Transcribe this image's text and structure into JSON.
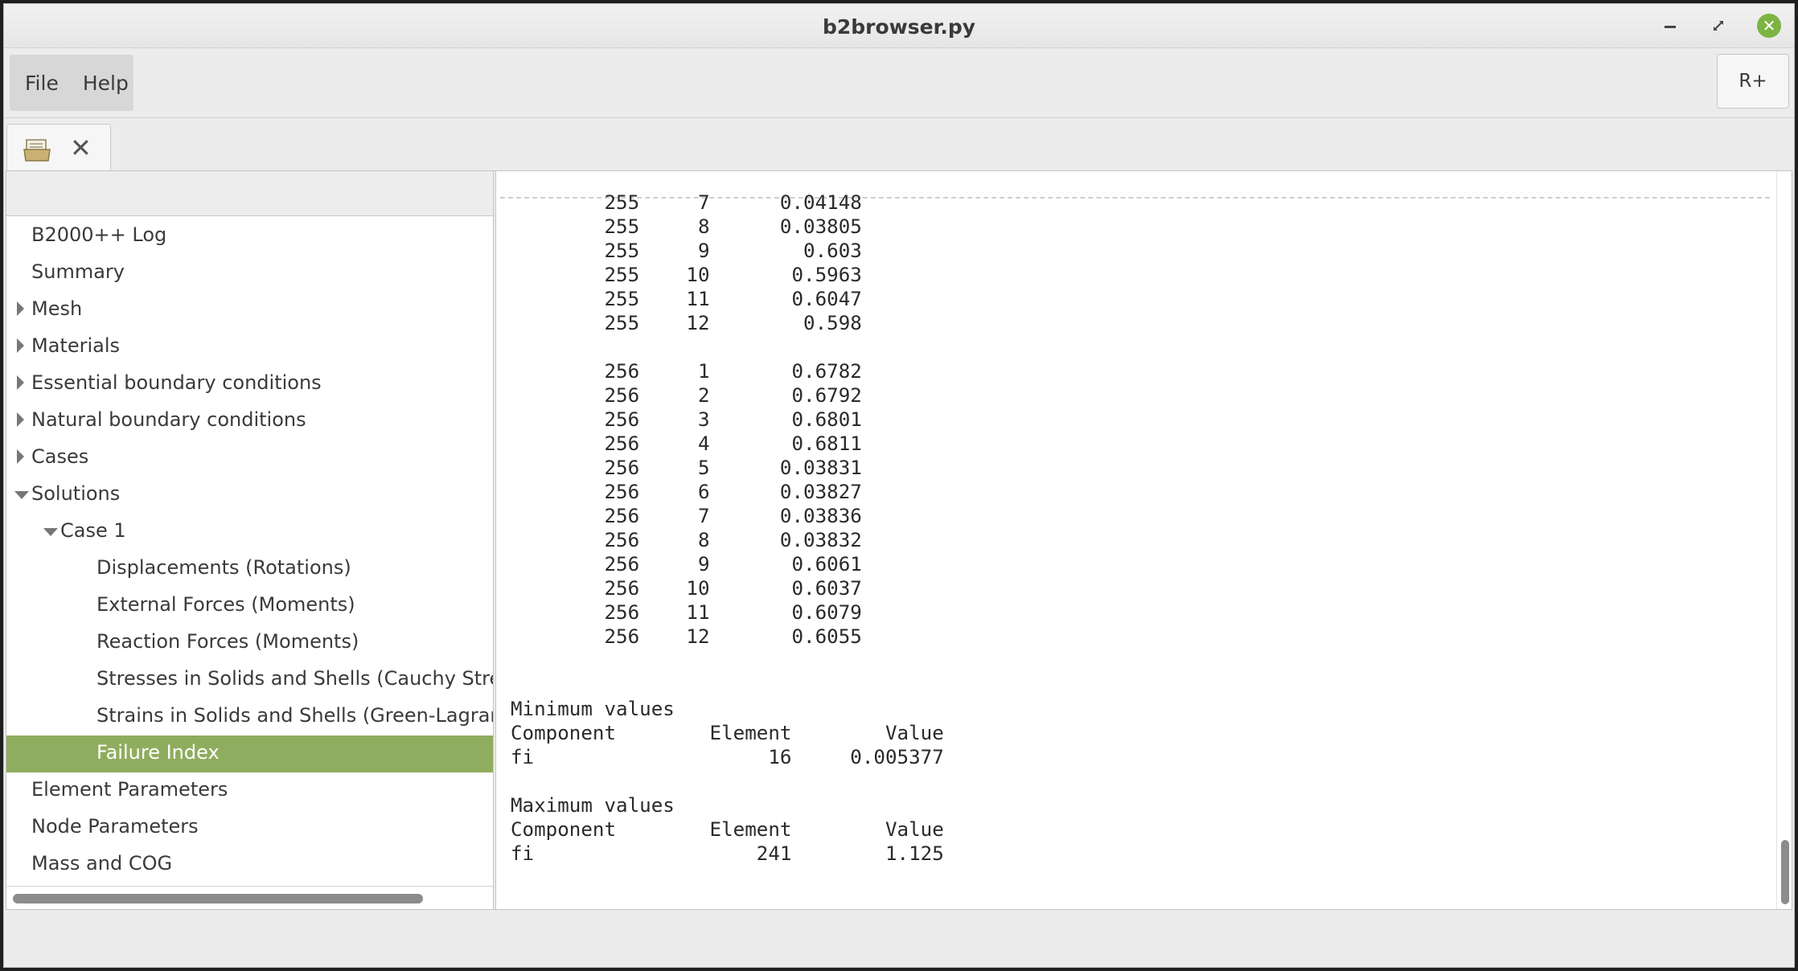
{
  "window": {
    "title": "b2browser.py",
    "close_glyph": "✕"
  },
  "menubar": {
    "items": [
      "File",
      "Help"
    ],
    "right_button": "R+"
  },
  "tab": {
    "icons": [
      "folder-icon",
      "close-icon"
    ],
    "close_glyph": "✕"
  },
  "tree": {
    "items": [
      {
        "label": "B2000++ Log",
        "level": 0,
        "expander": "none"
      },
      {
        "label": "Summary",
        "level": 0,
        "expander": "none"
      },
      {
        "label": "Mesh",
        "level": 0,
        "expander": "collapsed"
      },
      {
        "label": "Materials",
        "level": 0,
        "expander": "collapsed"
      },
      {
        "label": "Essential boundary conditions",
        "level": 0,
        "expander": "collapsed"
      },
      {
        "label": "Natural boundary conditions",
        "level": 0,
        "expander": "collapsed"
      },
      {
        "label": "Cases",
        "level": 0,
        "expander": "collapsed"
      },
      {
        "label": "Solutions",
        "level": 0,
        "expander": "expanded"
      },
      {
        "label": "Case 1",
        "level": 1,
        "expander": "expanded"
      },
      {
        "label": "Displacements (Rotations)",
        "level": 2,
        "expander": "none"
      },
      {
        "label": "External Forces (Moments)",
        "level": 2,
        "expander": "none"
      },
      {
        "label": "Reaction Forces (Moments)",
        "level": 2,
        "expander": "none"
      },
      {
        "label": "Stresses in Solids and Shells (Cauchy Stress",
        "level": 2,
        "expander": "none"
      },
      {
        "label": "Strains in Solids and Shells (Green-Lagrange",
        "level": 2,
        "expander": "none"
      },
      {
        "label": "Failure Index",
        "level": 2,
        "expander": "none",
        "selected": true
      },
      {
        "label": "Element Parameters",
        "level": 0,
        "expander": "none"
      },
      {
        "label": "Node Parameters",
        "level": 0,
        "expander": "none"
      },
      {
        "label": "Mass and COG",
        "level": 0,
        "expander": "none"
      }
    ],
    "selected_color": "#8fad5e"
  },
  "log": {
    "rows_a": [
      [
        "255",
        "7",
        "0.04148"
      ],
      [
        "255",
        "8",
        "0.03805"
      ],
      [
        "255",
        "9",
        "0.603"
      ],
      [
        "255",
        "10",
        "0.5963"
      ],
      [
        "255",
        "11",
        "0.6047"
      ],
      [
        "255",
        "12",
        "0.598"
      ]
    ],
    "rows_b": [
      [
        "256",
        "1",
        "0.6782"
      ],
      [
        "256",
        "2",
        "0.6792"
      ],
      [
        "256",
        "3",
        "0.6801"
      ],
      [
        "256",
        "4",
        "0.6811"
      ],
      [
        "256",
        "5",
        "0.03831"
      ],
      [
        "256",
        "6",
        "0.03827"
      ],
      [
        "256",
        "7",
        "0.03836"
      ],
      [
        "256",
        "8",
        "0.03832"
      ],
      [
        "256",
        "9",
        "0.6061"
      ],
      [
        "256",
        "10",
        "0.6037"
      ],
      [
        "256",
        "11",
        "0.6079"
      ],
      [
        "256",
        "12",
        "0.6055"
      ]
    ],
    "minimum": {
      "heading": "Minimum values",
      "columns": [
        "Component",
        "Element",
        "Value"
      ],
      "row": [
        "fi",
        "16",
        "0.005377"
      ]
    },
    "maximum": {
      "heading": "Maximum values",
      "columns": [
        "Component",
        "Element",
        "Value"
      ],
      "row": [
        "fi",
        "241",
        "1.125"
      ]
    }
  }
}
